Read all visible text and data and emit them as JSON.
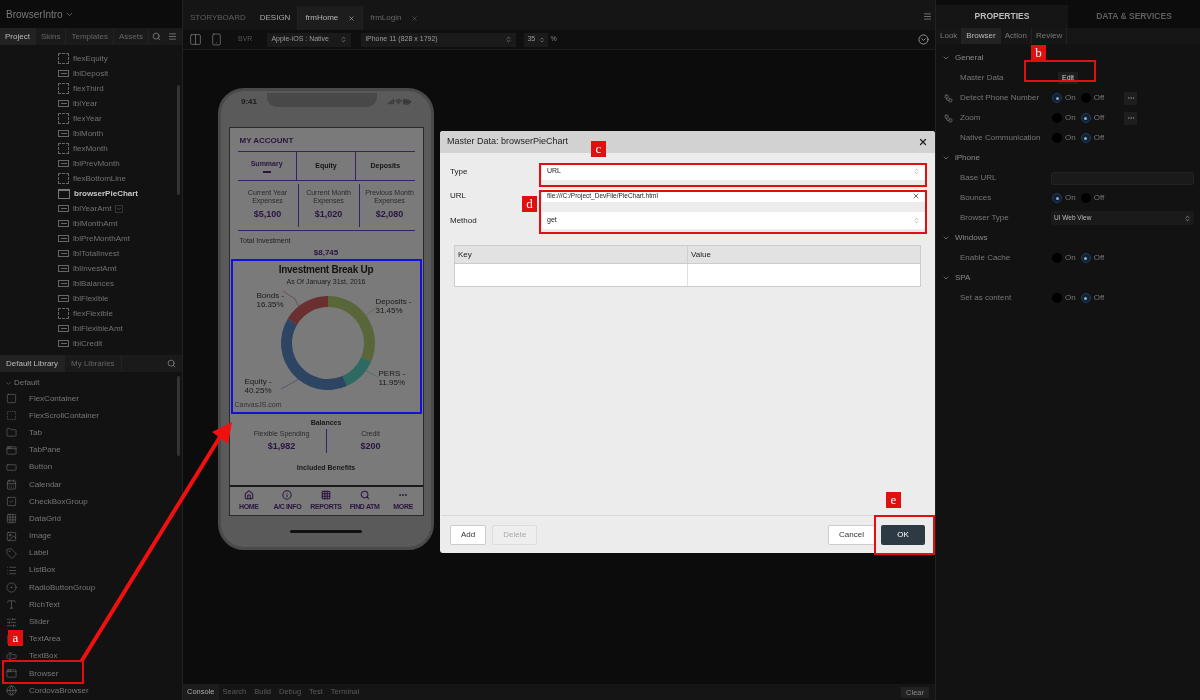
{
  "project": {
    "name": "BrowserIntro",
    "tabs": [
      {
        "label": "Project",
        "selected": true
      },
      {
        "label": "Skins",
        "selected": false
      },
      {
        "label": "Templates",
        "selected": false
      },
      {
        "label": "Assets",
        "selected": false
      }
    ],
    "tree": [
      {
        "label": "flexEquity",
        "kind": "container",
        "selected": false
      },
      {
        "label": "lblDeposit",
        "kind": "label",
        "selected": false
      },
      {
        "label": "flexThird",
        "kind": "container",
        "selected": false
      },
      {
        "label": "lblYear",
        "kind": "label",
        "selected": false
      },
      {
        "label": "flexYear",
        "kind": "container",
        "selected": false
      },
      {
        "label": "lblMonth",
        "kind": "label",
        "selected": false
      },
      {
        "label": "flexMonth",
        "kind": "container",
        "selected": false
      },
      {
        "label": "lblPrevMonth",
        "kind": "label",
        "selected": false
      },
      {
        "label": "flexBottomLine",
        "kind": "container",
        "selected": false
      },
      {
        "label": "browserPieChart",
        "kind": "browser",
        "selected": true
      },
      {
        "label": "lblYearAmt",
        "kind": "label",
        "selected": false,
        "hovered": true
      },
      {
        "label": "lblMonthAmt",
        "kind": "label",
        "selected": false
      },
      {
        "label": "lblPreMonthAmt",
        "kind": "label",
        "selected": false
      },
      {
        "label": "lblTotalInvest",
        "kind": "label",
        "selected": false
      },
      {
        "label": "lblInvestAmt",
        "kind": "label",
        "selected": false
      },
      {
        "label": "lblBalances",
        "kind": "label",
        "selected": false
      },
      {
        "label": "lblFlexible",
        "kind": "label",
        "selected": false
      },
      {
        "label": "flexFlexible",
        "kind": "container",
        "selected": false
      },
      {
        "label": "lblFlexibleAmt",
        "kind": "label",
        "selected": false
      },
      {
        "label": "lblCredit",
        "kind": "label",
        "selected": false
      }
    ]
  },
  "library": {
    "tabs": [
      {
        "label": "Default Library",
        "selected": true
      },
      {
        "label": "My Libraries",
        "selected": false
      }
    ],
    "group": {
      "label": "Default",
      "expanded": true
    },
    "items": [
      {
        "label": "FlexContainer",
        "kind": "container"
      },
      {
        "label": "FlexScrollContainer",
        "kind": "scroll"
      },
      {
        "label": "Tab",
        "kind": "tab"
      },
      {
        "label": "TabPane",
        "kind": "tabpane"
      },
      {
        "label": "Button",
        "kind": "button"
      },
      {
        "label": "Calendar",
        "kind": "calendar"
      },
      {
        "label": "CheckBoxGroup",
        "kind": "checkbox"
      },
      {
        "label": "DataGrid",
        "kind": "grid"
      },
      {
        "label": "Image",
        "kind": "image"
      },
      {
        "label": "Label",
        "kind": "label"
      },
      {
        "label": "ListBox",
        "kind": "listbox"
      },
      {
        "label": "RadioButtonGroup",
        "kind": "radio"
      },
      {
        "label": "RichText",
        "kind": "richtext"
      },
      {
        "label": "Slider",
        "kind": "slider"
      },
      {
        "label": "TextArea",
        "kind": "textarea"
      },
      {
        "label": "TextBox",
        "kind": "textbox"
      },
      {
        "label": "Browser",
        "kind": "browser"
      },
      {
        "label": "CordovaBrowser",
        "kind": "cordova"
      }
    ]
  },
  "editor": {
    "mode_tabs": [
      {
        "label": "STORYBOARD",
        "selected": false
      },
      {
        "label": "DESIGN",
        "selected": true
      }
    ],
    "form_tabs": [
      {
        "label": "frmHome",
        "selected": true
      },
      {
        "label": "frmLogin",
        "selected": false
      }
    ],
    "toolbar": {
      "behavior_button": "BVR",
      "platform": "Apple-iOS : Native",
      "device": "iPhone 11 (828 x 1792)",
      "zoom": "35",
      "zoom_unit": "%"
    }
  },
  "phone": {
    "time": "9:41",
    "heading": "MY ACCOUNT",
    "tabs": [
      {
        "label": "Summary",
        "selected": true
      },
      {
        "label": "Equity",
        "selected": false
      },
      {
        "label": "Deposits",
        "selected": false
      }
    ],
    "stats": [
      {
        "label": "Current Year Expenses",
        "value": "$5,100"
      },
      {
        "label": "Current Month Expenses",
        "value": "$1,020"
      },
      {
        "label": "Previous Month Expenses",
        "value": "$2,080"
      }
    ],
    "total_label": "Total Investment",
    "total_value": "$8,745",
    "chart_data": {
      "type": "donut",
      "title": "Investment Break Up",
      "subtitle": "As Of January 31st, 2016",
      "categories": [
        "Deposits -",
        "PERS -",
        "Equity -",
        "Bonds -"
      ],
      "values": [
        31.45,
        11.95,
        40.25,
        16.35
      ],
      "value_labels": [
        "31.45%",
        "11.95%",
        "40.25%",
        "16.35%"
      ]
    },
    "chart_credit": "CanvasJS.com",
    "balances_title": "Balances",
    "balances": [
      {
        "label": "Flexible Spending",
        "value": "$1,982"
      },
      {
        "label": "Credit",
        "value": "$200"
      }
    ],
    "benefits_title": "Included Benefits",
    "nav": [
      {
        "label": "HOME",
        "kind": "home"
      },
      {
        "label": "A/C INFO",
        "kind": "info"
      },
      {
        "label": "REPORTS",
        "kind": "grid"
      },
      {
        "label": "FIND ATM",
        "kind": "search"
      },
      {
        "label": "MORE",
        "kind": "more"
      }
    ]
  },
  "dialog": {
    "title": "Master Data: browserPieChart",
    "fields": [
      {
        "label": "Type",
        "value": "URL",
        "kind": "select"
      },
      {
        "label": "URL",
        "value": "file:///C:/Project_DevFile/PieChart.html",
        "kind": "text"
      },
      {
        "label": "Method",
        "value": "get",
        "kind": "select"
      }
    ],
    "table": {
      "columns": [
        "Key",
        "Value"
      ]
    },
    "buttons": [
      {
        "label": "Add",
        "disabled": false,
        "primary": false
      },
      {
        "label": "Delete",
        "disabled": true,
        "primary": false
      },
      {
        "label": "Cancel",
        "disabled": false,
        "primary": false
      },
      {
        "label": "OK",
        "disabled": false,
        "primary": true
      }
    ]
  },
  "properties": {
    "tabs": [
      {
        "label": "PROPERTIES",
        "selected": true
      },
      {
        "label": "DATA & SERVICES",
        "selected": false
      }
    ],
    "subtabs": [
      {
        "label": "Look",
        "selected": false
      },
      {
        "label": "Browser",
        "selected": true
      },
      {
        "label": "Action",
        "selected": false
      },
      {
        "label": "Review",
        "selected": false
      }
    ],
    "sections": [
      {
        "title": "General",
        "expanded": true,
        "rows": [
          {
            "label": "Master Data",
            "kind": "button",
            "button": "Edit"
          },
          {
            "label": "Detect Phone Number",
            "kind": "radio",
            "linked": true,
            "more": true,
            "options": [
              {
                "label": "On",
                "selected": true
              },
              {
                "label": "Off",
                "selected": false
              }
            ]
          },
          {
            "label": "Zoom",
            "kind": "radio",
            "linked": true,
            "more": true,
            "options": [
              {
                "label": "On",
                "selected": false
              },
              {
                "label": "Off",
                "selected": true
              }
            ]
          },
          {
            "label": "Native Communication",
            "kind": "radio",
            "linked": false,
            "more": false,
            "options": [
              {
                "label": "On",
                "selected": false
              },
              {
                "label": "Off",
                "selected": true
              }
            ]
          }
        ]
      },
      {
        "title": "iPhone",
        "expanded": true,
        "rows": [
          {
            "label": "Base URL",
            "kind": "input"
          },
          {
            "label": "Bounces",
            "kind": "radio",
            "linked": false,
            "more": false,
            "options": [
              {
                "label": "On",
                "selected": true
              },
              {
                "label": "Off",
                "selected": false
              }
            ]
          },
          {
            "label": "Browser Type",
            "kind": "select",
            "value": "UI Web View"
          }
        ]
      },
      {
        "title": "Windows",
        "expanded": true,
        "rows": [
          {
            "label": "Enable Cache",
            "kind": "radio",
            "linked": false,
            "more": false,
            "options": [
              {
                "label": "On",
                "selected": false
              },
              {
                "label": "Off",
                "selected": true
              }
            ]
          }
        ]
      },
      {
        "title": "SPA",
        "expanded": true,
        "rows": [
          {
            "label": "Set as content",
            "kind": "radio",
            "linked": false,
            "more": false,
            "options": [
              {
                "label": "On",
                "selected": false
              },
              {
                "label": "Off",
                "selected": true
              }
            ]
          }
        ]
      }
    ]
  },
  "console": {
    "tabs": [
      {
        "label": "Console",
        "selected": true
      },
      {
        "label": "Search",
        "selected": false
      },
      {
        "label": "Build",
        "selected": false
      },
      {
        "label": "Debug",
        "selected": false
      },
      {
        "label": "Test",
        "selected": false
      },
      {
        "label": "Terminal",
        "selected": false
      }
    ],
    "clear": "Clear"
  },
  "annotations": [
    "a",
    "b",
    "c",
    "d",
    "e"
  ]
}
